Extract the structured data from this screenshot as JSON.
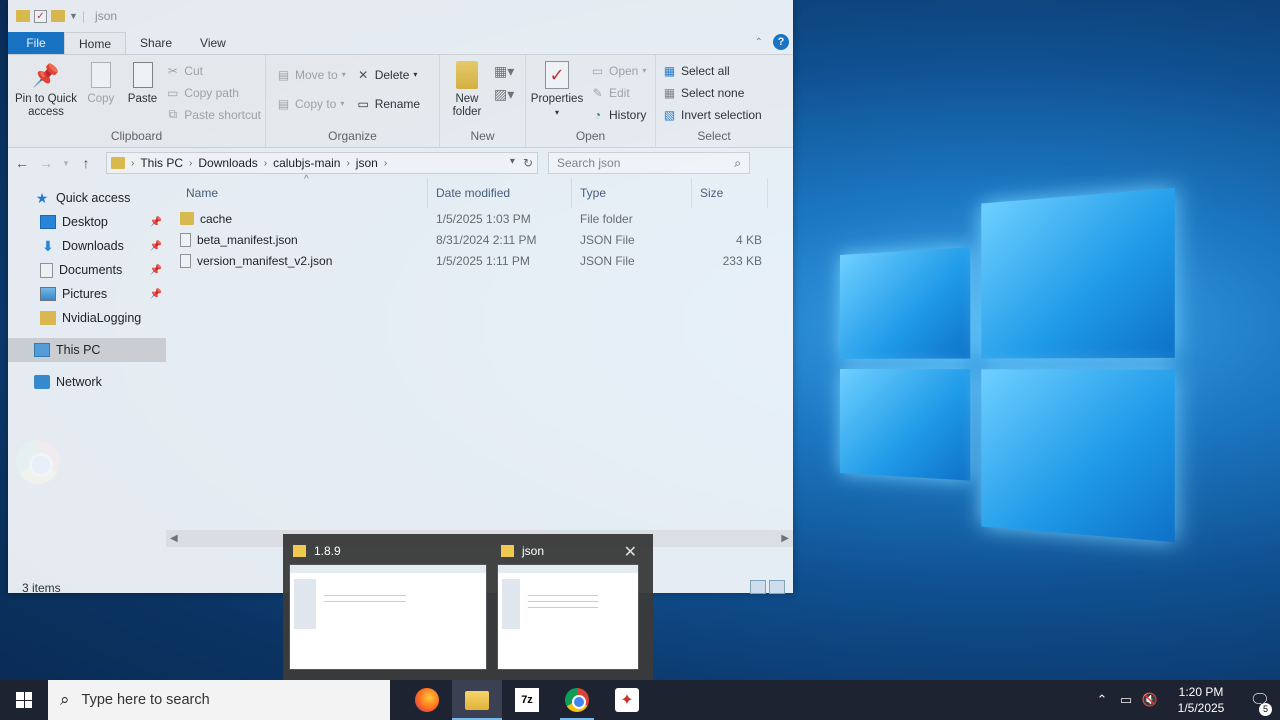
{
  "window": {
    "title": "json",
    "tabs": {
      "file": "File",
      "home": "Home",
      "share": "Share",
      "view": "View"
    }
  },
  "ribbon": {
    "clipboard": {
      "label": "Clipboard",
      "pin": "Pin to Quick access",
      "copy": "Copy",
      "paste": "Paste",
      "cut": "Cut",
      "copy_path": "Copy path",
      "paste_shortcut": "Paste shortcut"
    },
    "organize": {
      "label": "Organize",
      "move_to": "Move to",
      "copy_to": "Copy to",
      "delete": "Delete",
      "rename": "Rename"
    },
    "new": {
      "label": "New",
      "new_folder": "New folder"
    },
    "open": {
      "label": "Open",
      "properties": "Properties",
      "open": "Open",
      "edit": "Edit",
      "history": "History"
    },
    "select": {
      "label": "Select",
      "select_all": "Select all",
      "select_none": "Select none",
      "invert": "Invert selection"
    }
  },
  "address": {
    "crumbs": [
      "This PC",
      "Downloads",
      "calubjs-main",
      "json"
    ],
    "search_placeholder": "Search json"
  },
  "nav": {
    "quick_access": "Quick access",
    "items": [
      "Desktop",
      "Downloads",
      "Documents",
      "Pictures",
      "NvidiaLogging"
    ],
    "this_pc": "This PC",
    "network": "Network"
  },
  "columns": {
    "name": "Name",
    "date": "Date modified",
    "type": "Type",
    "size": "Size"
  },
  "files": [
    {
      "name": "cache",
      "date": "1/5/2025 1:03 PM",
      "type": "File folder",
      "size": "",
      "kind": "folder"
    },
    {
      "name": "beta_manifest.json",
      "date": "8/31/2024 2:11 PM",
      "type": "JSON File",
      "size": "4 KB",
      "kind": "file"
    },
    {
      "name": "version_manifest_v2.json",
      "date": "1/5/2025 1:11 PM",
      "type": "JSON File",
      "size": "233 KB",
      "kind": "file"
    }
  ],
  "status": {
    "count": "3 items"
  },
  "thumbnails": [
    {
      "title": "1.8.9"
    },
    {
      "title": "json"
    }
  ],
  "taskbar": {
    "search_placeholder": "Type here to search",
    "apps": [
      "firefox-icon",
      "file-explorer-icon",
      "7zip-icon",
      "chrome-icon",
      "app-icon"
    ],
    "time": "1:20 PM",
    "date": "1/5/2025",
    "notifications": "5"
  },
  "colors": {
    "accent": "#1979ca",
    "taskbar": "#1d2331"
  }
}
